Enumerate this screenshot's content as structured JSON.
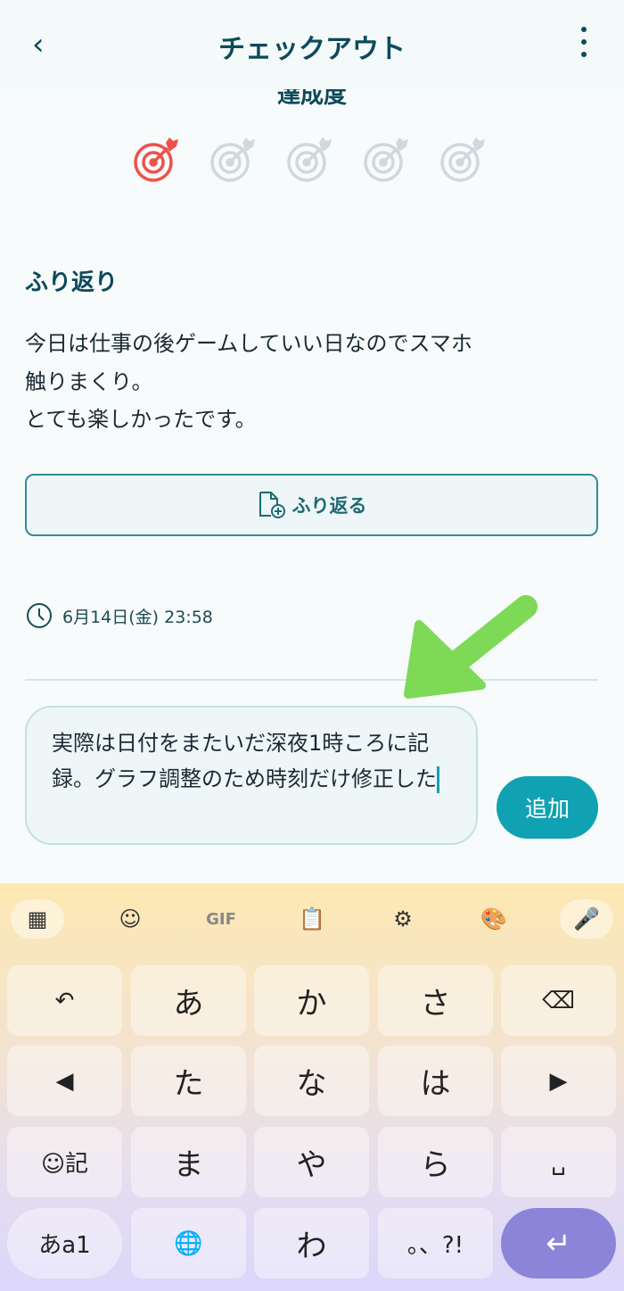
{
  "header": {
    "title": "チェックアウト",
    "back_icon": "chevron-left-icon",
    "menu_icon": "more-vertical-icon"
  },
  "achievement": {
    "label": "達成度",
    "level": 1,
    "max": 5,
    "active_color": "#f0504a",
    "inactive_color": "#cfd8dc"
  },
  "reflection": {
    "title": "ふり返り",
    "body": "今日は仕事の後ゲームしていい日なのでスマホ\n触りまくり。\nとても楽しかったです。",
    "button_label": "ふり返る"
  },
  "timestamp": "6月14日(金) 23:58",
  "comment": {
    "value": "実際は日付をまたいだ深夜1時ころに記録。グラフ調整のため時刻だけ修正した",
    "add_label": "追加"
  },
  "keyboard": {
    "toolbar": [
      "apps-icon",
      "sticker-icon",
      "GIF",
      "clipboard-icon",
      "gear-icon",
      "palette-icon",
      "mic-icon"
    ],
    "rows": [
      [
        "↶",
        "あ",
        "か",
        "さ",
        "⌫"
      ],
      [
        "◀",
        "た",
        "な",
        "は",
        "▶"
      ],
      [
        "☺記",
        "ま",
        "や",
        "ら",
        "␣"
      ],
      [
        "あa1",
        "🌐",
        "わ",
        "。、?!",
        "↵"
      ]
    ]
  },
  "colors": {
    "accent": "#10a2b3",
    "primary_text": "#0d4a5a",
    "enter_key": "#8c84d8",
    "annotation_arrow": "#7ed957"
  }
}
